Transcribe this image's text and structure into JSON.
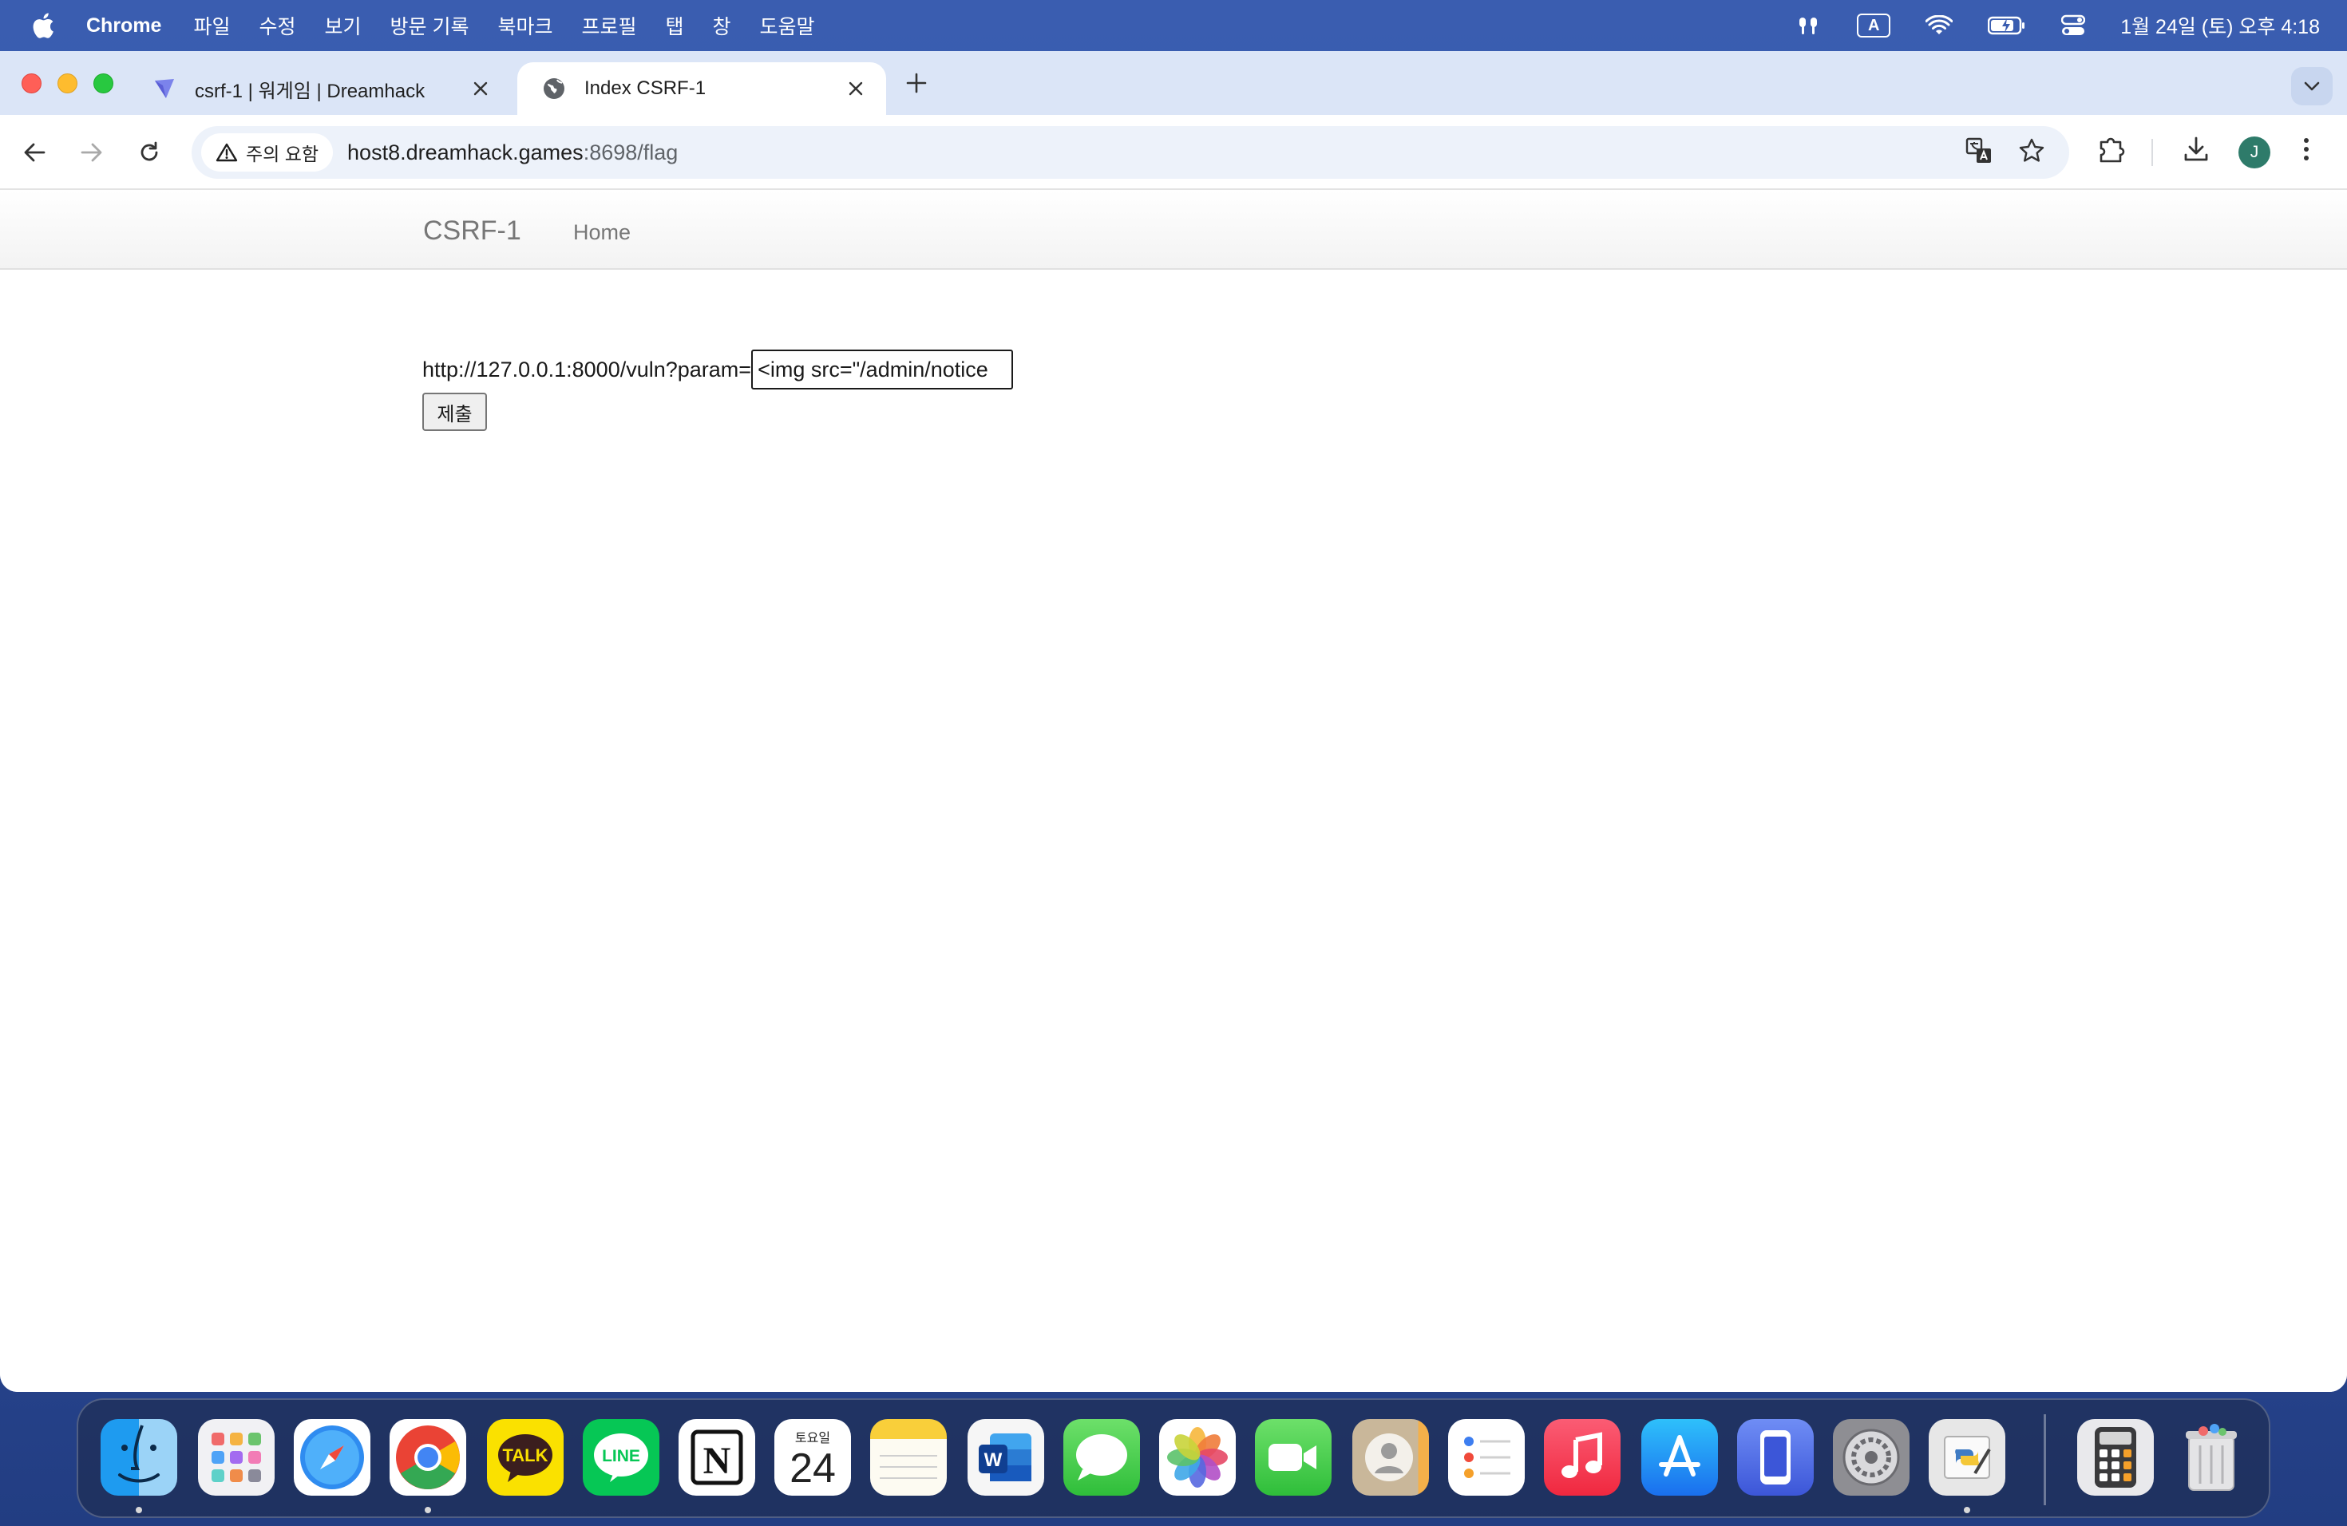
{
  "menubar": {
    "app_name": "Chrome",
    "menus": [
      "파일",
      "수정",
      "보기",
      "방문 기록",
      "북마크",
      "프로필",
      "탭",
      "창",
      "도움말"
    ],
    "input_source": "A",
    "clock": "1월 24일 (토) 오후 4:18"
  },
  "tabs": [
    {
      "title": "csrf-1 | 워게임 | Dreamhack",
      "favicon": "dreamhack-icon",
      "active": false
    },
    {
      "title": "Index CSRF-1",
      "favicon": "globe-icon",
      "active": true
    }
  ],
  "toolbar": {
    "security_chip": "주의 요함",
    "url_host": "host8.dreamhack.games",
    "url_rest": ":8698/flag",
    "avatar_letter": "J"
  },
  "page": {
    "brand": "CSRF-1",
    "nav_home": "Home",
    "form": {
      "label": "http://127.0.0.1:8000/vuln?param=",
      "input_value": "<img src=\"/admin/notice",
      "submit_label": "제출"
    }
  },
  "dock": {
    "apps": [
      {
        "name": "finder",
        "running": true
      },
      {
        "name": "launchpad",
        "running": false
      },
      {
        "name": "safari",
        "running": false
      },
      {
        "name": "chrome",
        "running": true
      },
      {
        "name": "kakaotalk",
        "label": "TALK",
        "running": false
      },
      {
        "name": "line",
        "label": "LINE",
        "running": false
      },
      {
        "name": "notion",
        "label": "N",
        "running": false
      },
      {
        "name": "calendar",
        "weekday": "토요일",
        "day": "24",
        "running": false
      },
      {
        "name": "notes",
        "running": false
      },
      {
        "name": "word",
        "label": "W",
        "running": false
      },
      {
        "name": "messages",
        "running": false
      },
      {
        "name": "photos",
        "running": false
      },
      {
        "name": "facetime",
        "running": false
      },
      {
        "name": "contacts",
        "running": false
      },
      {
        "name": "reminders",
        "running": false
      },
      {
        "name": "music",
        "running": false
      },
      {
        "name": "app-store",
        "running": false
      },
      {
        "name": "simulator",
        "running": false
      },
      {
        "name": "system-settings",
        "running": false
      },
      {
        "name": "python-idle",
        "running": true
      },
      {
        "name": "calculator",
        "running": false
      },
      {
        "name": "trash",
        "running": false
      }
    ]
  },
  "colors": {
    "menubar": "#3a5caf",
    "tabstrip": "#dbe5f7",
    "omnibox": "#edf2fa",
    "page_text": "#1a1a1a",
    "nav_text": "#777777"
  }
}
